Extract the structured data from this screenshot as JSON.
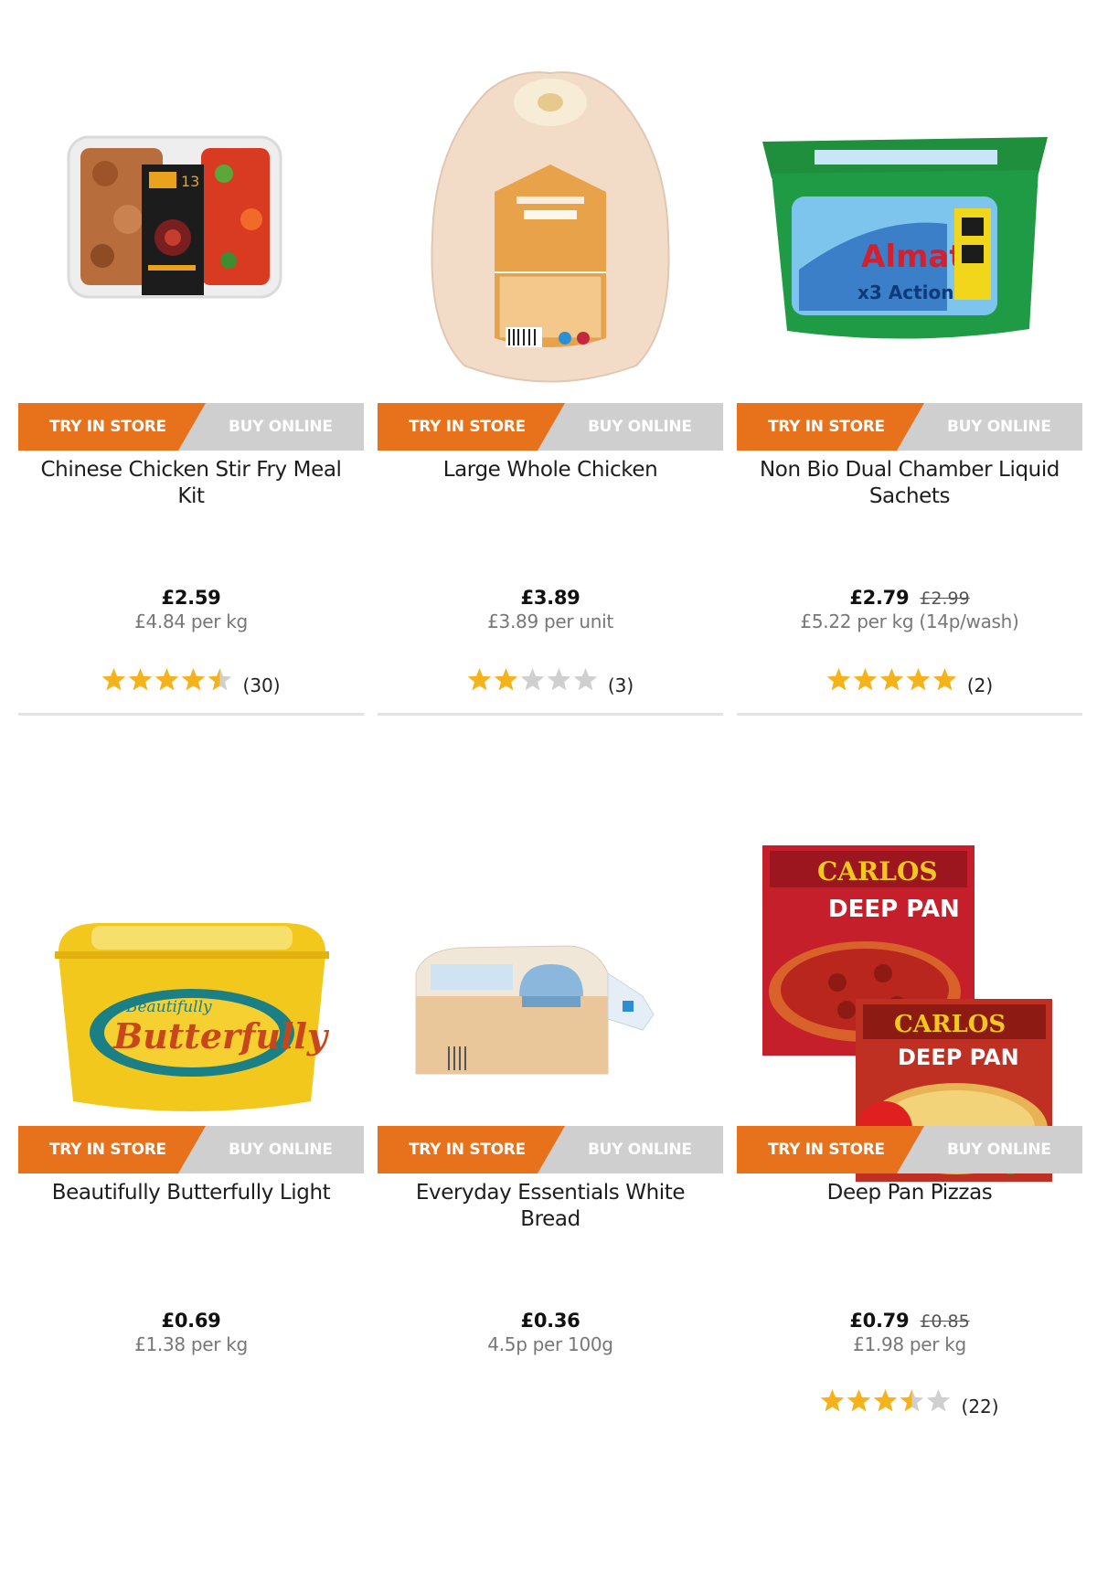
{
  "labels": {
    "try_in_store": "TRY IN STORE",
    "buy_online": "BUY ONLINE"
  },
  "colors": {
    "try_in_store": "#e8711c",
    "buy_online": "#cfcfcf",
    "star": "#f6b21b",
    "star_empty": "#cfcfcf"
  },
  "products": [
    {
      "name": "Chinese Chicken Stir Fry Meal Kit",
      "price": "£2.59",
      "was_price": "",
      "unit_price": "£4.84 per kg",
      "rating": 4.5,
      "review_count": "(30)",
      "image": "chinese-chicken-stir-fry-tray"
    },
    {
      "name": "Large Whole Chicken",
      "price": "£3.89",
      "was_price": "",
      "unit_price": "£3.89 per unit",
      "rating": 2,
      "review_count": "(3)",
      "image": "whole-chicken-pack"
    },
    {
      "name": "Non Bio Dual Chamber Liquid Sachets",
      "price": "£2.79",
      "was_price": "£2.99",
      "unit_price": "£5.22 per kg (14p/wash)",
      "rating": 5,
      "review_count": "(2)",
      "image": "almat-detergent-tub"
    },
    {
      "name": "Beautifully Butterfully Light",
      "price": "£0.69",
      "was_price": "",
      "unit_price": "£1.38 per kg",
      "rating": null,
      "review_count": "",
      "image": "butter-spread-tub"
    },
    {
      "name": "Everyday Essentials White Bread",
      "price": "£0.36",
      "was_price": "",
      "unit_price": "4.5p per 100g",
      "rating": null,
      "review_count": "",
      "image": "white-bread-loaf"
    },
    {
      "name": "Deep Pan Pizzas",
      "price": "£0.79",
      "was_price": "£0.85",
      "unit_price": "£1.98 per kg",
      "rating": 3.5,
      "review_count": "(22)",
      "image": "deep-pan-pizza-boxes"
    }
  ]
}
